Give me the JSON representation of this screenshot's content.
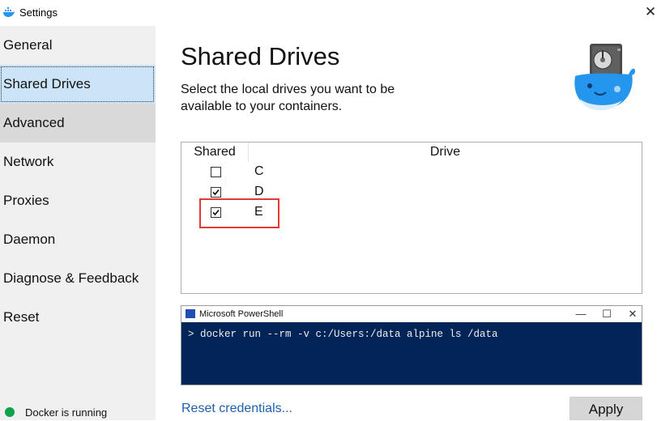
{
  "window": {
    "title": "Settings",
    "close_glyph": "✕"
  },
  "sidebar": {
    "items": [
      {
        "label": "General"
      },
      {
        "label": "Shared Drives"
      },
      {
        "label": "Advanced"
      },
      {
        "label": "Network"
      },
      {
        "label": "Proxies"
      },
      {
        "label": "Daemon"
      },
      {
        "label": "Diagnose & Feedback"
      },
      {
        "label": "Reset"
      }
    ],
    "selected_index": 1,
    "status": {
      "text": "Docker is running",
      "color": "#0fa14c"
    }
  },
  "main": {
    "title": "Shared Drives",
    "description": "Select the local drives you want to be available to your containers.",
    "table": {
      "headers": {
        "shared": "Shared",
        "drive": "Drive"
      },
      "rows": [
        {
          "drive": "C",
          "shared": false
        },
        {
          "drive": "D",
          "shared": true
        },
        {
          "drive": "E",
          "shared": true
        }
      ]
    },
    "powershell": {
      "title": "Microsoft PowerShell",
      "minimize": "—",
      "maximize": "☐",
      "close": "✕",
      "command": "> docker run --rm -v c:/Users:/data alpine ls /data"
    },
    "reset_link": "Reset credentials...",
    "apply_label": "Apply"
  },
  "colors": {
    "accent_selected": "#cce4f7",
    "highlight_box": "#e53935",
    "powershell_bg": "#022456",
    "link": "#1e5fae"
  },
  "icons": [
    "docker-app-icon",
    "docker-whale-drive-icon",
    "powershell-icon",
    "close-icon",
    "checkbox-icon"
  ]
}
